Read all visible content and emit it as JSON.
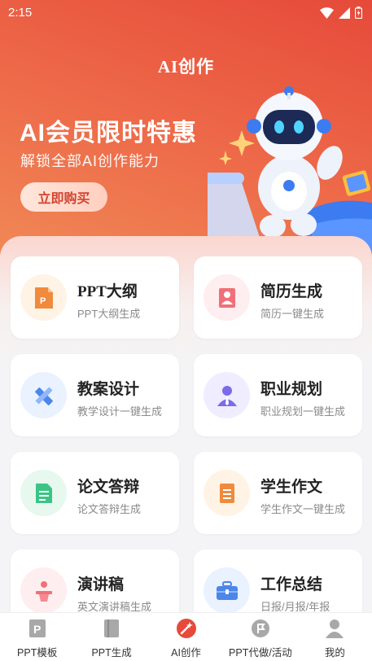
{
  "status_bar": {
    "time": "2:15"
  },
  "header": {
    "title": "AI创作"
  },
  "promo": {
    "title": "AI会员限时特惠",
    "subtitle": "解锁全部AI创作能力",
    "button_label": "立即购买"
  },
  "cards": [
    {
      "title": "PPT大纲",
      "subtitle": "PPT大纲生成",
      "icon": "ppt-outline-icon",
      "color": "#f08a3c",
      "bg": "#fff3e6"
    },
    {
      "title": "简历生成",
      "subtitle": "简历一键生成",
      "icon": "resume-icon",
      "color": "#f0707a",
      "bg": "#ffeef0"
    },
    {
      "title": "教案设计",
      "subtitle": "教学设计一键生成",
      "icon": "ruler-pencil-icon",
      "color": "#4c86e8",
      "bg": "#eaf2ff"
    },
    {
      "title": "职业规划",
      "subtitle": "职业规划一键生成",
      "icon": "career-person-icon",
      "color": "#7b6be8",
      "bg": "#efedff"
    },
    {
      "title": "论文答辩",
      "subtitle": "论文答辩生成",
      "icon": "paper-doc-icon",
      "color": "#3cc486",
      "bg": "#e7f8ef"
    },
    {
      "title": "学生作文",
      "subtitle": "学生作文一键生成",
      "icon": "essay-doc-icon",
      "color": "#f08a3c",
      "bg": "#fff3e6"
    },
    {
      "title": "演讲稿",
      "subtitle": "英文演讲稿生成",
      "icon": "speech-podium-icon",
      "color": "#f0707a",
      "bg": "#ffeef0"
    },
    {
      "title": "工作总结",
      "subtitle": "日报/月报/年报",
      "icon": "briefcase-icon",
      "color": "#4c86e8",
      "bg": "#eaf2ff"
    }
  ],
  "tabs": [
    {
      "label": "PPT模板",
      "icon": "ppt-template-icon"
    },
    {
      "label": "PPT生成",
      "icon": "ppt-generate-icon"
    },
    {
      "label": "AI创作",
      "icon": "ai-create-icon",
      "active": true
    },
    {
      "label": "PPT代做/活动",
      "icon": "ppt-service-icon"
    },
    {
      "label": "我的",
      "icon": "profile-icon"
    }
  ],
  "colors": {
    "accent": "#e64a3a",
    "tab_active": "#e64a3a",
    "tab_inactive": "#9a9a9a"
  }
}
